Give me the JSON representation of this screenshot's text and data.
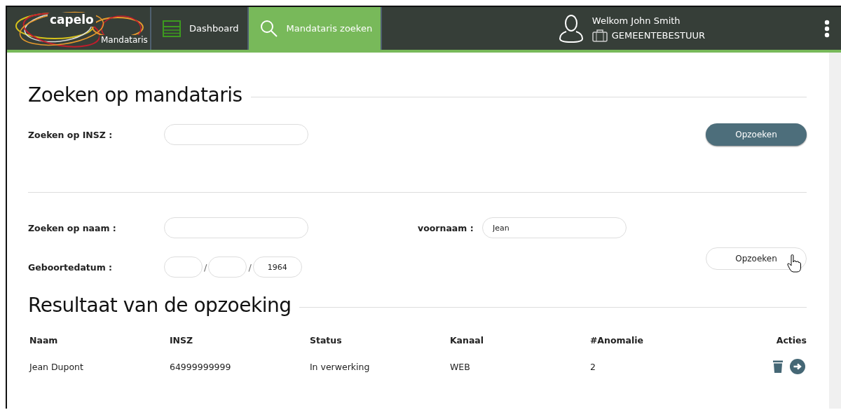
{
  "header": {
    "logo": {
      "brand": "capelo",
      "product": "Mandataris"
    },
    "nav": [
      {
        "label": "Dashboard",
        "kind": "dashboard",
        "selected": false
      },
      {
        "label": "Mandataris zoeken",
        "kind": "search",
        "selected": true
      }
    ],
    "user": {
      "welcome": "Welkom John Smith",
      "role": "GEMEENTEBESTUUR"
    }
  },
  "search": {
    "title": "Zoeken op mandataris",
    "insz": {
      "label": "Zoeken op INSZ :",
      "button": {
        "label": "Opzoeken",
        "kind": "primary"
      }
    },
    "name": {
      "label": "Zoeken op naam :",
      "firstname_label": "voornaam :",
      "firstname_value": "Jean"
    },
    "birthdate": {
      "label": "Geboortedatum :",
      "separators": [
        "/",
        "/"
      ],
      "year": "1964"
    },
    "name_button": {
      "label": "Opzoeken",
      "kind": "secondary"
    }
  },
  "results": {
    "title": "Resultaat van de opzoeking",
    "columns": [
      "Naam",
      "INSZ",
      "Status",
      "Kanaal",
      "#Anomalie",
      "Acties"
    ],
    "rows": [
      {
        "cells": [
          "Jean Dupont",
          "64999999999",
          "In verwerking",
          "WEB",
          "2"
        ]
      }
    ]
  }
}
